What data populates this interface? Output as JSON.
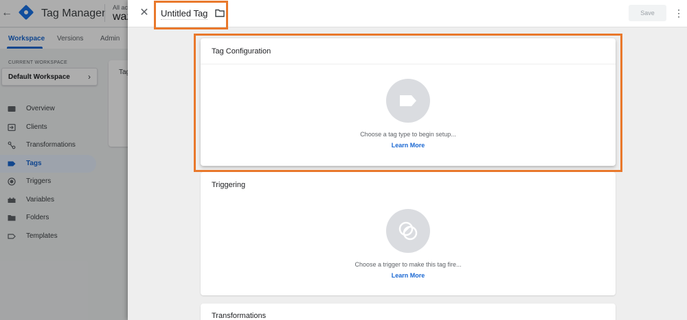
{
  "app": {
    "name": "Tag Manager",
    "account_label": "All acc",
    "account_name": "waz"
  },
  "nav_tabs": [
    "Workspace",
    "Versions",
    "Admin"
  ],
  "workspace": {
    "label": "CURRENT WORKSPACE",
    "selected": "Default Workspace"
  },
  "sidebar": {
    "items": [
      {
        "label": "Overview",
        "icon": "overview-icon"
      },
      {
        "label": "Clients",
        "icon": "clients-icon"
      },
      {
        "label": "Transformations",
        "icon": "transformations-icon"
      },
      {
        "label": "Tags",
        "icon": "tag-icon",
        "active": true
      },
      {
        "label": "Triggers",
        "icon": "trigger-icon"
      },
      {
        "label": "Variables",
        "icon": "variables-icon"
      },
      {
        "label": "Folders",
        "icon": "folder-icon"
      },
      {
        "label": "Templates",
        "icon": "template-icon"
      }
    ]
  },
  "background_card": {
    "text": "Tag"
  },
  "panel": {
    "title": "Untitled Tag",
    "save_label": "Save",
    "highlight_color": "#e9782b",
    "config": {
      "title": "Tag Configuration",
      "hint": "Choose a tag type to begin setup...",
      "link": "Learn More"
    },
    "triggering": {
      "title": "Triggering",
      "hint": "Choose a trigger to make this tag fire...",
      "link": "Learn More"
    },
    "transformations": {
      "title": "Transformations"
    }
  }
}
